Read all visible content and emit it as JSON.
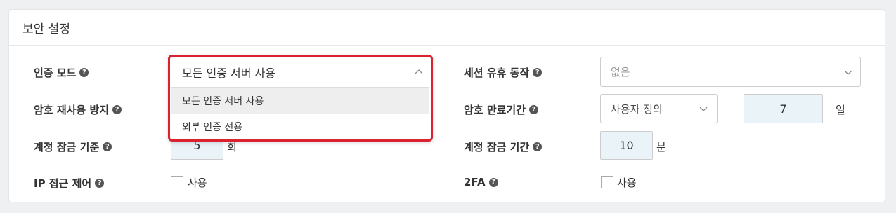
{
  "panel": {
    "title": "보안 설정"
  },
  "left": {
    "auth_mode": {
      "label": "인증 모드",
      "selected": "모든 인증 서버 사용",
      "options": [
        "모든 인증 서버 사용",
        "외부 인증 전용"
      ]
    },
    "password_reuse": {
      "label": "암호 재사용 방지"
    },
    "lockout_threshold": {
      "label": "계정 잠금 기준",
      "value": "5",
      "unit": "회"
    },
    "ip_access": {
      "label": "IP 접근 제어",
      "checkbox_label": "사용"
    }
  },
  "right": {
    "session_idle": {
      "label": "세션 유휴 동작",
      "placeholder": "없음"
    },
    "password_expiry": {
      "label": "암호 만료기간",
      "selected": "사용자 정의",
      "value": "7",
      "unit": "일"
    },
    "lockout_duration": {
      "label": "계정 잠금 기간",
      "value": "10",
      "unit": "분"
    },
    "twofa": {
      "label": "2FA",
      "checkbox_label": "사용"
    }
  },
  "help_glyph": "?",
  "colors": {
    "highlight_border": "#d9232e",
    "input_bg": "#eaf3f8"
  }
}
